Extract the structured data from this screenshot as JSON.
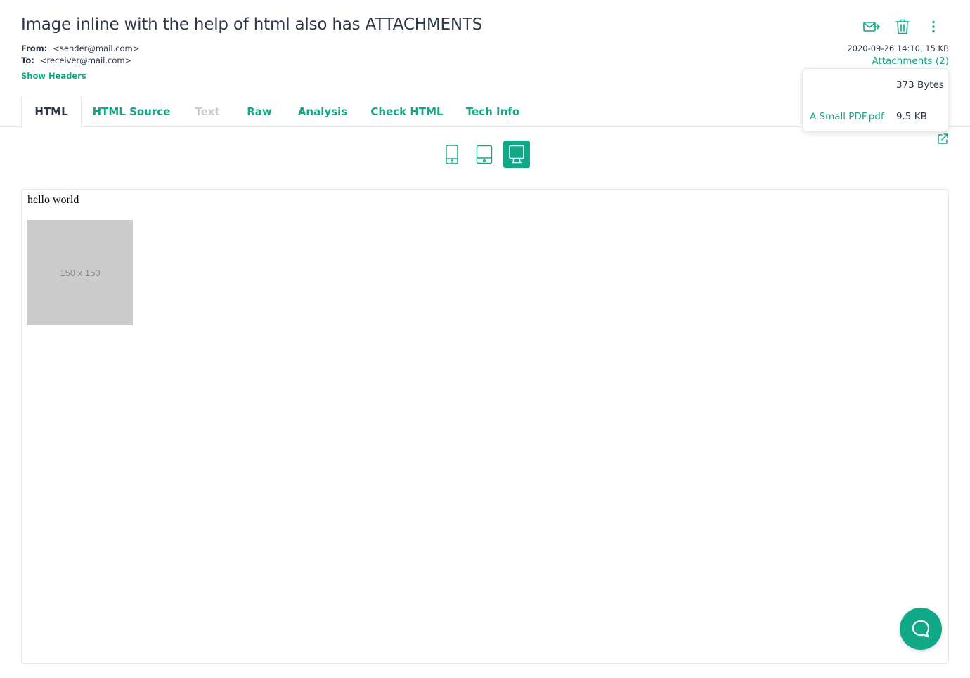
{
  "message": {
    "subject": "Image inline with the help of html also has ATTACHMENTS",
    "from_label": "From:",
    "from_value": "<sender@mail.com>",
    "to_label": "To:",
    "to_value": "<receiver@mail.com>",
    "show_headers": "Show Headers",
    "date_size": "2020-09-26 14:10, 15 KB",
    "attachments_link": "Attachments (2)"
  },
  "actions": {
    "icons": [
      "forward-mail-icon",
      "trash-icon",
      "more-vertical-icon"
    ]
  },
  "attachments": [
    {
      "name": "",
      "size": "373 Bytes"
    },
    {
      "name": "A Small PDF.pdf",
      "size": "9.5 KB"
    }
  ],
  "tabs": [
    {
      "label": "HTML",
      "state": "active"
    },
    {
      "label": "HTML Source",
      "state": "normal"
    },
    {
      "label": "Text",
      "state": "disabled"
    },
    {
      "label": "Raw",
      "state": "normal"
    },
    {
      "label": "Analysis",
      "state": "normal"
    },
    {
      "label": "Check HTML",
      "state": "normal"
    },
    {
      "label": "Tech Info",
      "state": "normal"
    }
  ],
  "devices": {
    "items": [
      "mobile-icon",
      "tablet-icon",
      "desktop-icon"
    ],
    "active": "desktop-icon"
  },
  "preview": {
    "body_text": "hello world",
    "image_placeholder": "150 x 150"
  },
  "colors": {
    "accent": "#10a887",
    "text": "#2d3748",
    "disabled": "#c8ced8",
    "border": "#e2e8f0",
    "placeholder_bg": "#cccccc"
  }
}
